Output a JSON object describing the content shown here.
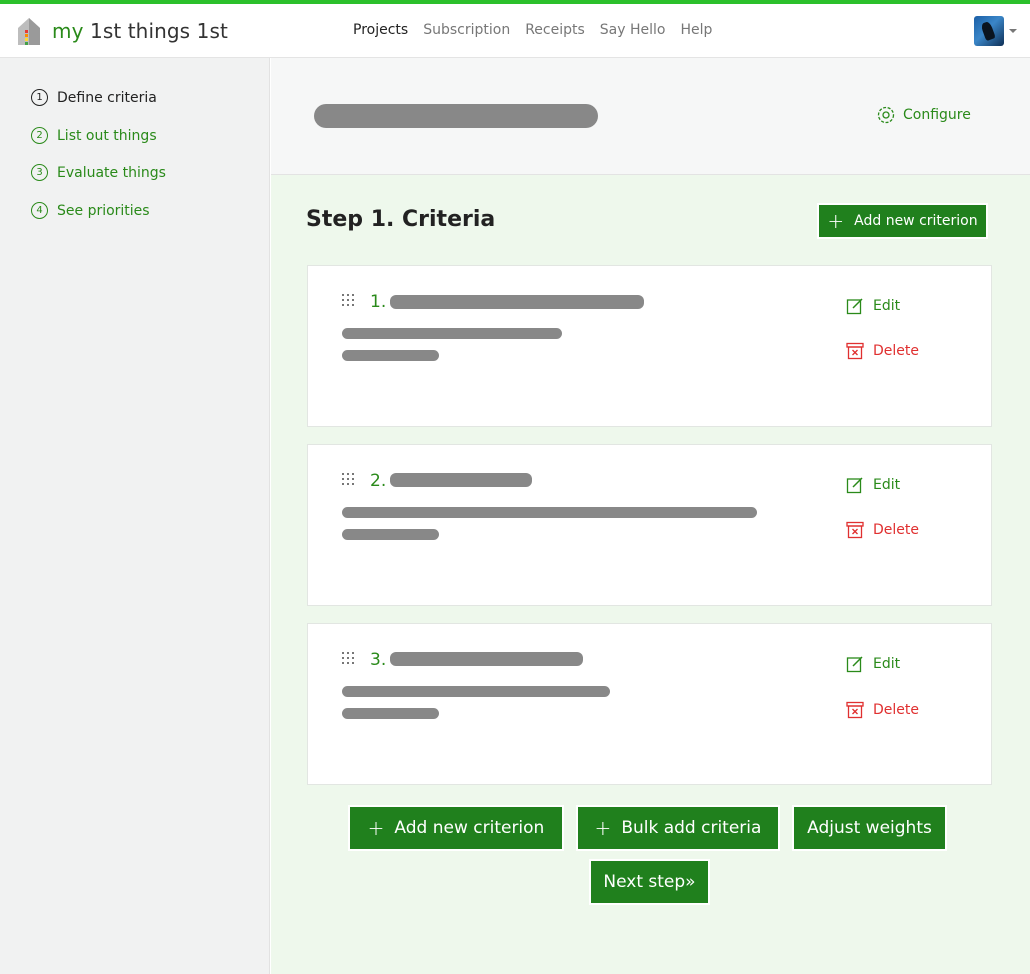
{
  "brand": {
    "my": "my",
    "rest": " 1st things 1st"
  },
  "nav": {
    "links": [
      {
        "label": "Projects",
        "active": true
      },
      {
        "label": "Subscription",
        "active": false
      },
      {
        "label": "Receipts",
        "active": false
      },
      {
        "label": "Say Hello",
        "active": false
      },
      {
        "label": "Help",
        "active": false
      }
    ]
  },
  "sidebar": {
    "items": [
      {
        "num": "1",
        "label": "Define criteria",
        "current": true
      },
      {
        "num": "2",
        "label": "List out things",
        "current": false
      },
      {
        "num": "3",
        "label": "Evaluate things",
        "current": false
      },
      {
        "num": "4",
        "label": "See priorities",
        "current": false
      }
    ]
  },
  "header": {
    "configure_label": "Configure"
  },
  "main": {
    "step_title": "Step 1. Criteria",
    "add_criterion_label": "Add new criterion",
    "criteria": [
      {
        "num": "1."
      },
      {
        "num": "2."
      },
      {
        "num": "3."
      }
    ],
    "edit_label": "Edit",
    "delete_label": "Delete",
    "bottom_buttons": {
      "add": "Add new criterion",
      "bulk": "Bulk add criteria",
      "weights": "Adjust weights",
      "next": "Next step»"
    }
  },
  "colors": {
    "accent": "#2bc02b",
    "brand_green": "#2a8a1a",
    "button_green": "#20801d",
    "delete_red": "#e03030",
    "main_bg": "#eef8ec"
  },
  "icons": [
    "house-logo-icon",
    "configure-gear-icon",
    "drag-handle-icon",
    "edit-icon",
    "delete-icon",
    "plus-icon",
    "chevron-down-icon"
  ]
}
